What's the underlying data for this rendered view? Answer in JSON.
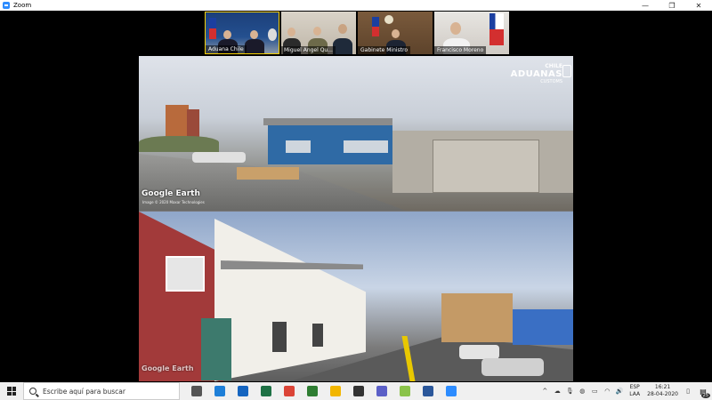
{
  "window": {
    "title": "Zoom",
    "controls": [
      "—",
      "❐",
      "✕"
    ]
  },
  "participants": [
    {
      "name": "Aduana Chile"
    },
    {
      "name": "Miguel Angel Qu..."
    },
    {
      "name": "Gabinete Ministro"
    },
    {
      "name": "Francisco Moreno"
    }
  ],
  "shared_screen": {
    "logo": {
      "country": "CHILE",
      "name": "ADUANAS",
      "sub": "CUSTOMS"
    },
    "watermark_top": "Google Earth",
    "watermark_top_sub": "Image © 2020 Maxar Technologies",
    "watermark_bottom": "Google Earth"
  },
  "taskbar": {
    "search_placeholder": "Escribe aquí para buscar",
    "apps": [
      {
        "icon": "task-view-icon",
        "color": "#555555"
      },
      {
        "icon": "edge-icon",
        "color": "#1e7fd8"
      },
      {
        "icon": "mail-icon",
        "color": "#1565c0"
      },
      {
        "icon": "excel-icon",
        "color": "#1e7145"
      },
      {
        "icon": "chrome-icon",
        "color": "#db4437"
      },
      {
        "icon": "maps-icon",
        "color": "#2e7d32"
      },
      {
        "icon": "explorer-icon",
        "color": "#f2b600"
      },
      {
        "icon": "store-icon",
        "color": "#333333"
      },
      {
        "icon": "teams-icon",
        "color": "#5b5fc7"
      },
      {
        "icon": "paint-icon",
        "color": "#8bc34a"
      },
      {
        "icon": "word-icon",
        "color": "#2b579a"
      },
      {
        "icon": "zoom-icon",
        "color": "#2d8cff"
      }
    ],
    "lang_top": "ESP",
    "lang_bottom": "LAA",
    "time": "16:21",
    "date": "28-04-2020",
    "notifications": "25"
  }
}
